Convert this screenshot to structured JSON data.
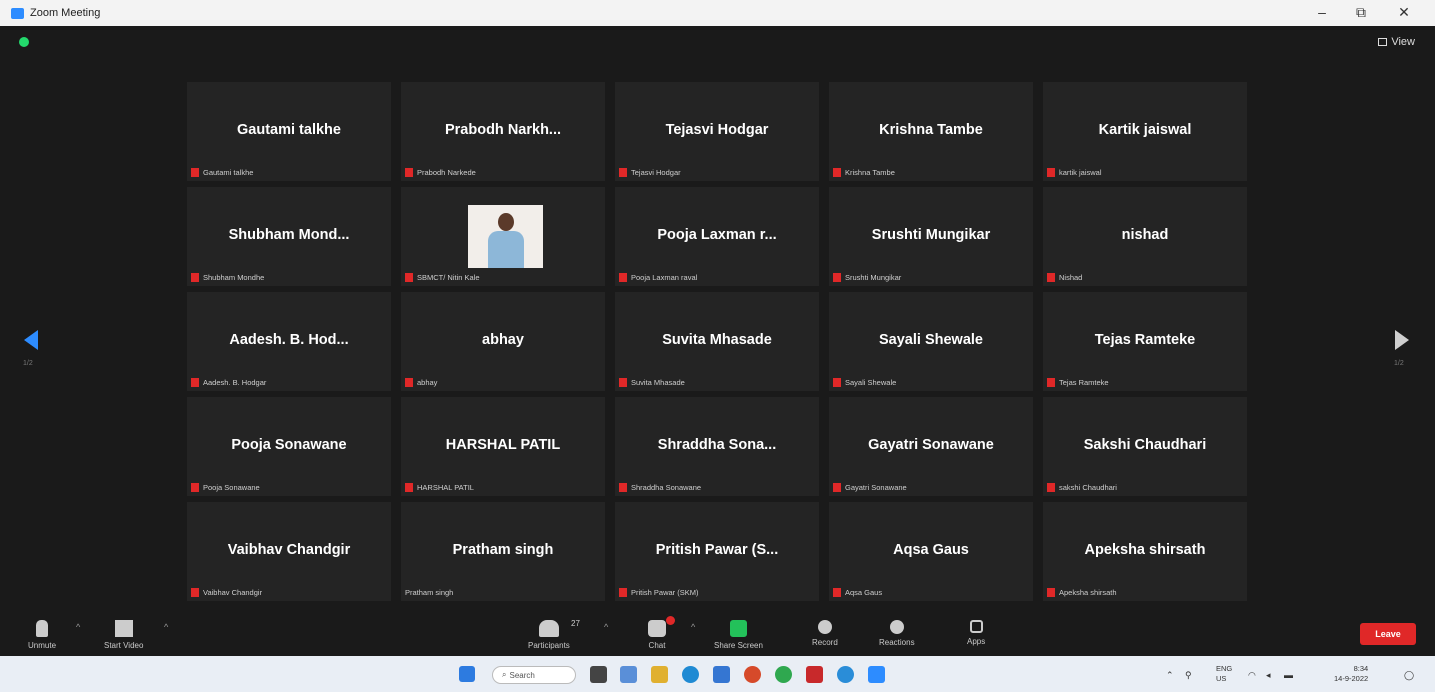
{
  "window": {
    "title": "Zoom Meeting"
  },
  "view_button": {
    "label": "View"
  },
  "pagination": {
    "prev": "1/2",
    "next": "1/2"
  },
  "participants_tiles": [
    {
      "display": "Gautami talkhe",
      "label": "Gautami talkhe",
      "muted": true
    },
    {
      "display": "Prabodh Narkh...",
      "label": "Prabodh Narkede",
      "muted": true
    },
    {
      "display": "Tejasvi Hodgar",
      "label": "Tejasvi Hodgar",
      "muted": true
    },
    {
      "display": "Krishna Tambe",
      "label": "Krishna Tambe",
      "muted": true
    },
    {
      "display": "Kartik jaiswal",
      "label": "kartik jaiswal",
      "muted": true
    },
    {
      "display": "Shubham Mond...",
      "label": "Shubham Mondhe",
      "muted": true
    },
    {
      "display": "",
      "label": "SBMCT/ Nitin Kale",
      "muted": true,
      "photo": true
    },
    {
      "display": "Pooja Laxman r...",
      "label": "Pooja Laxman raval",
      "muted": true
    },
    {
      "display": "Srushti Mungikar",
      "label": "Srushti Mungikar",
      "muted": true
    },
    {
      "display": "nishad",
      "label": "Nishad",
      "muted": true
    },
    {
      "display": "Aadesh. B. Hod...",
      "label": "Aadesh. B. Hodgar",
      "muted": true
    },
    {
      "display": "abhay",
      "label": "abhay",
      "muted": true
    },
    {
      "display": "Suvita Mhasade",
      "label": "Suvita Mhasade",
      "muted": true
    },
    {
      "display": "Sayali Shewale",
      "label": "Sayali Shewale",
      "muted": true
    },
    {
      "display": "Tejas Ramteke",
      "label": "Tejas Ramteke",
      "muted": true
    },
    {
      "display": "Pooja Sonawane",
      "label": "Pooja Sonawane",
      "muted": true
    },
    {
      "display": "HARSHAL PATIL",
      "label": "HARSHAL PATIL",
      "muted": true
    },
    {
      "display": "Shraddha Sona...",
      "label": "Shraddha Sonawane",
      "muted": true
    },
    {
      "display": "Gayatri Sonawane",
      "label": "Gayatri Sonawane",
      "muted": true
    },
    {
      "display": "Sakshi Chaudhari",
      "label": "sakshi Chaudhari",
      "muted": true
    },
    {
      "display": "Vaibhav Chandgir",
      "label": "Vaibhav Chandgir",
      "muted": true
    },
    {
      "display": "Pratham singh",
      "label": "Pratham singh",
      "muted": false
    },
    {
      "display": "Pritish Pawar (S...",
      "label": "Pritish Pawar (SKM)",
      "muted": true
    },
    {
      "display": "Aqsa Gaus",
      "label": "Aqsa Gaus",
      "muted": true
    },
    {
      "display": "Apeksha shirsath",
      "label": "Apeksha shirsath",
      "muted": true
    }
  ],
  "toolbar": {
    "unmute": "Unmute",
    "start_video": "Start Video",
    "participants": "Participants",
    "participants_count": "27",
    "chat": "Chat",
    "share_screen": "Share Screen",
    "record": "Record",
    "reactions": "Reactions",
    "apps": "Apps",
    "leave": "Leave"
  },
  "taskbar": {
    "search": "Search",
    "lang": "ENG",
    "region": "US",
    "time": "8:34",
    "date": "14-9-2022"
  },
  "colors": {
    "accent": "#2d8cff",
    "leave": "#e02828",
    "share": "#23c15a",
    "tile_bg": "#242424"
  }
}
